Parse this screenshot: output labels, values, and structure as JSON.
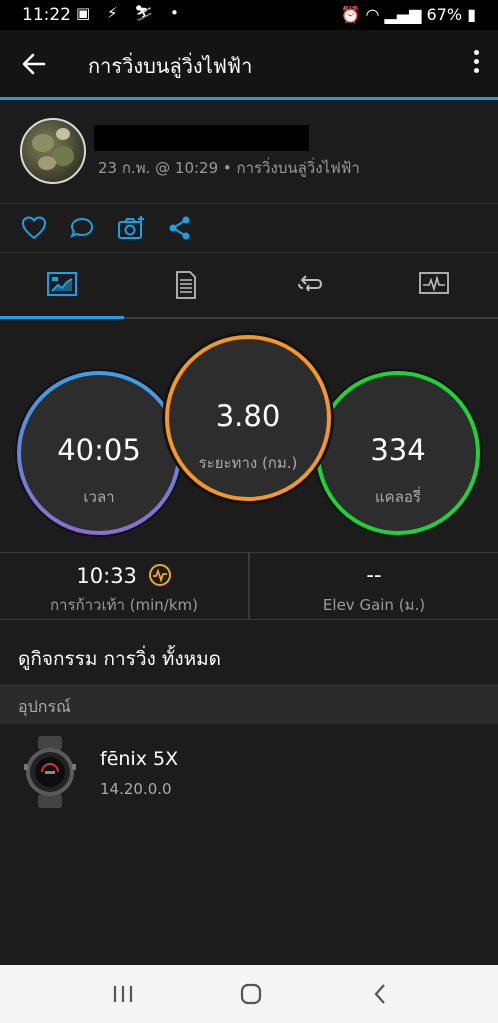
{
  "status": {
    "time": "11:22",
    "battery": "67%"
  },
  "appbar": {
    "title": "การวิ่งบนลู่วิ่งไฟฟ้า"
  },
  "activity": {
    "meta": "23 ก.พ. @ 10:29 • การวิ่งบนลู่วิ่งไฟฟ้า"
  },
  "stats": {
    "time": {
      "value": "40:05",
      "label": "เวลา"
    },
    "distance": {
      "value": "3.80",
      "label": "ระยะทาง (กม.)"
    },
    "calories": {
      "value": "334",
      "label": "แคลอรี่"
    },
    "pace": {
      "value": "10:33",
      "label": "การก้าวเท้า (min/km)"
    },
    "elev": {
      "value": "--",
      "label": "Elev Gain (ม.)"
    }
  },
  "see_all": "ดูกิจกรรม การวิ่ง ทั้งหมด",
  "section": {
    "devices": "อุปกรณ์"
  },
  "device": {
    "name": "fēnix 5X",
    "version": "14.20.0.0"
  },
  "colors": {
    "accent": "#1aa0e6",
    "time_ring": "#7b6fd0",
    "distance_ring": "#f5962a",
    "calories_ring": "#1ed23a",
    "pace_icon": "#f5a623"
  }
}
